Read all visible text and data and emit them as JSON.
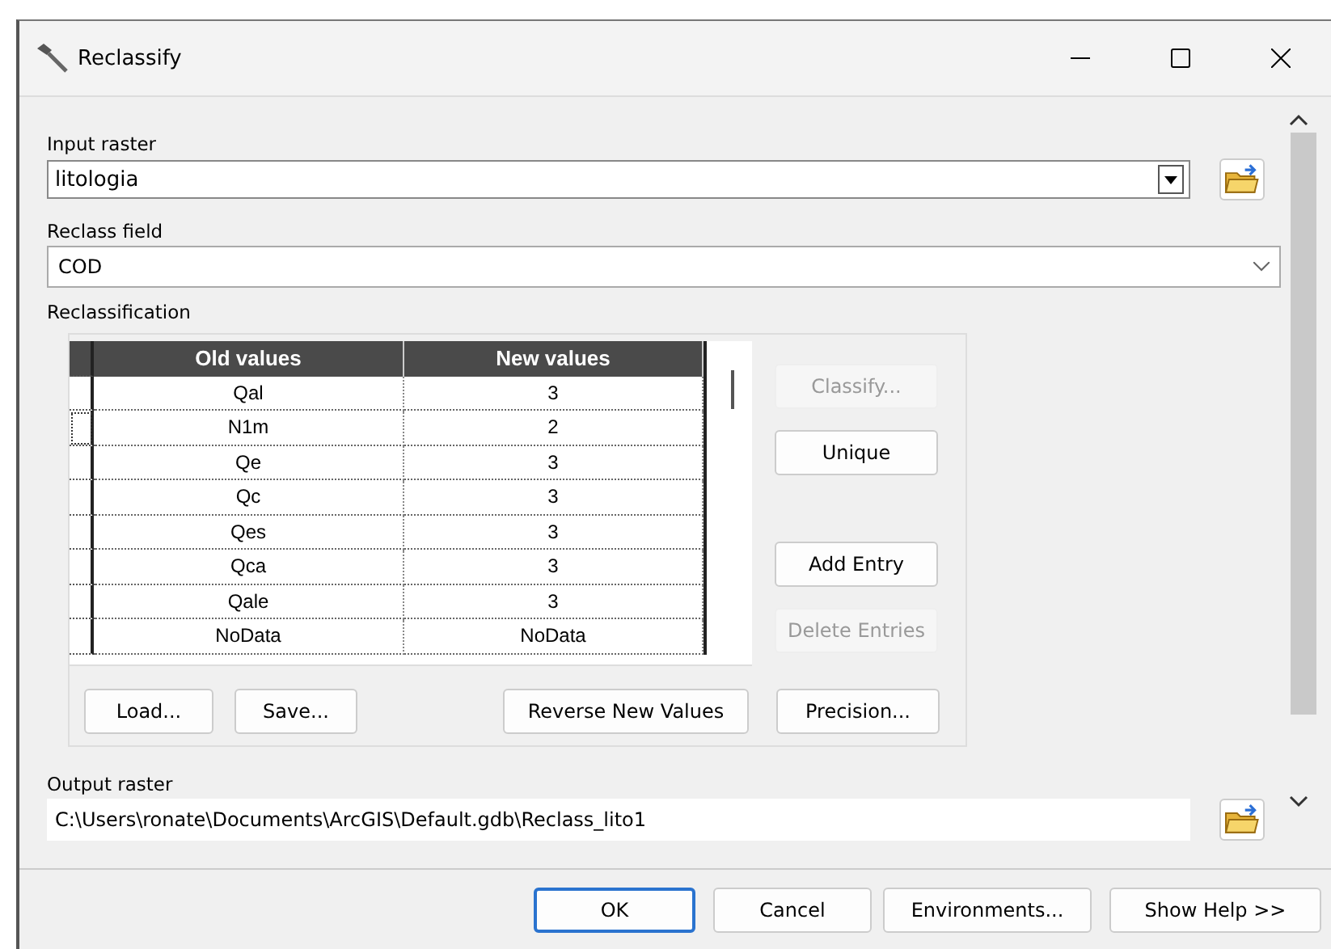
{
  "window": {
    "title": "Reclassify"
  },
  "input_raster": {
    "label": "Input raster",
    "value": "litologia"
  },
  "reclass_field": {
    "label": "Reclass field",
    "value": "COD"
  },
  "reclassification": {
    "label": "Reclassification",
    "table": {
      "columns": [
        "Old values",
        "New values"
      ],
      "rows": [
        {
          "old": "Qal",
          "new": "3",
          "focused": false
        },
        {
          "old": "N1m",
          "new": "2",
          "focused": true
        },
        {
          "old": "Qe",
          "new": "3",
          "focused": false
        },
        {
          "old": "Qc",
          "new": "3",
          "focused": false
        },
        {
          "old": "Qes",
          "new": "3",
          "focused": false
        },
        {
          "old": "Qca",
          "new": "3",
          "focused": false
        },
        {
          "old": "Qale",
          "new": "3",
          "focused": false
        },
        {
          "old": "NoData",
          "new": "NoData",
          "focused": false
        }
      ]
    },
    "side_buttons": [
      {
        "label": "Classify...",
        "disabled": true
      },
      {
        "label": "Unique",
        "disabled": false
      },
      {
        "label": "Add Entry",
        "disabled": false
      },
      {
        "label": "Delete Entries",
        "disabled": true
      }
    ],
    "bottom_buttons": [
      {
        "label": "Load..."
      },
      {
        "label": "Save..."
      },
      {
        "label": "Reverse New Values"
      },
      {
        "label": "Precision..."
      }
    ]
  },
  "output_raster": {
    "label": "Output raster",
    "value": "C:\\Users\\ronate\\Documents\\ArcGIS\\Default.gdb\\Reclass_lito1"
  },
  "footer_buttons": [
    {
      "label": "OK",
      "default": true
    },
    {
      "label": "Cancel",
      "default": false
    },
    {
      "label": "Environments...",
      "default": false
    },
    {
      "label": "Show Help >>",
      "default": false
    }
  ]
}
